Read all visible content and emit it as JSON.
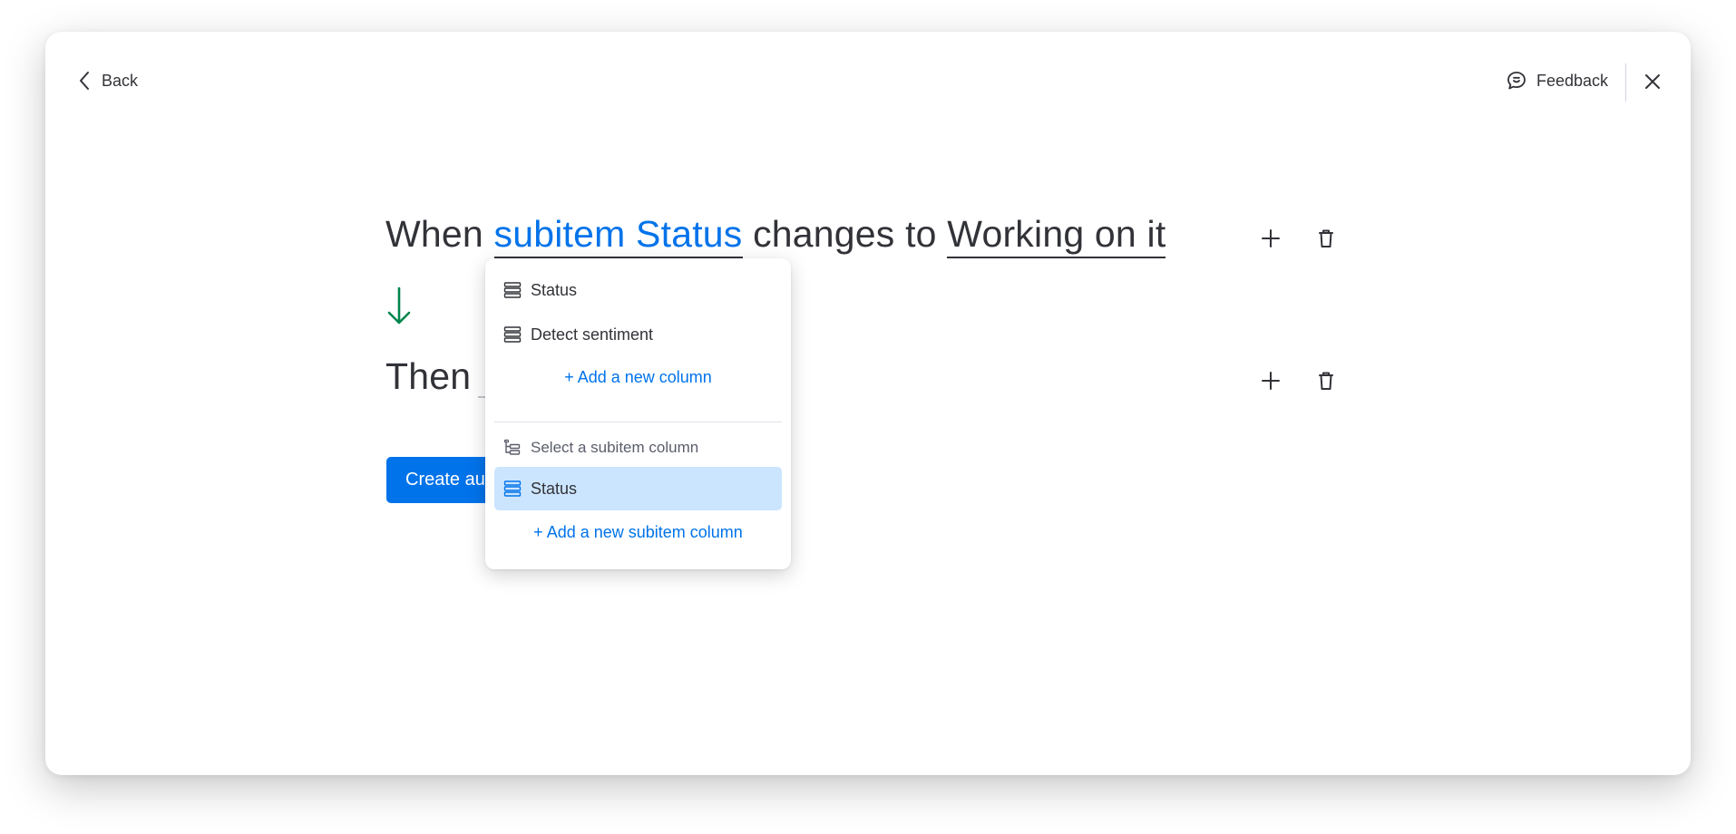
{
  "header": {
    "back_label": "Back",
    "feedback_label": "Feedback"
  },
  "recipe": {
    "trigger": {
      "when": "When",
      "column": "subitem Status",
      "changes_to": "changes to",
      "value": "Working on it"
    },
    "action": {
      "then": "Then"
    },
    "create_button_label": "Create au"
  },
  "dropdown": {
    "items": [
      {
        "label": "Status",
        "icon": "column-icon"
      },
      {
        "label": "Detect sentiment",
        "icon": "column-icon"
      }
    ],
    "add_column_label": "+ Add a new column",
    "subitem_group_label": "Select a subitem column",
    "subitem_group_icon": "subitem-icon",
    "subitem_items": [
      {
        "label": "Status",
        "icon": "column-icon",
        "selected": true
      }
    ],
    "add_subitem_column_label": "+ Add a new subitem column"
  },
  "colors": {
    "primary": "#0073ea",
    "selected_bg": "#cce5ff",
    "arrow_green": "#00854d",
    "text": "#323338"
  }
}
